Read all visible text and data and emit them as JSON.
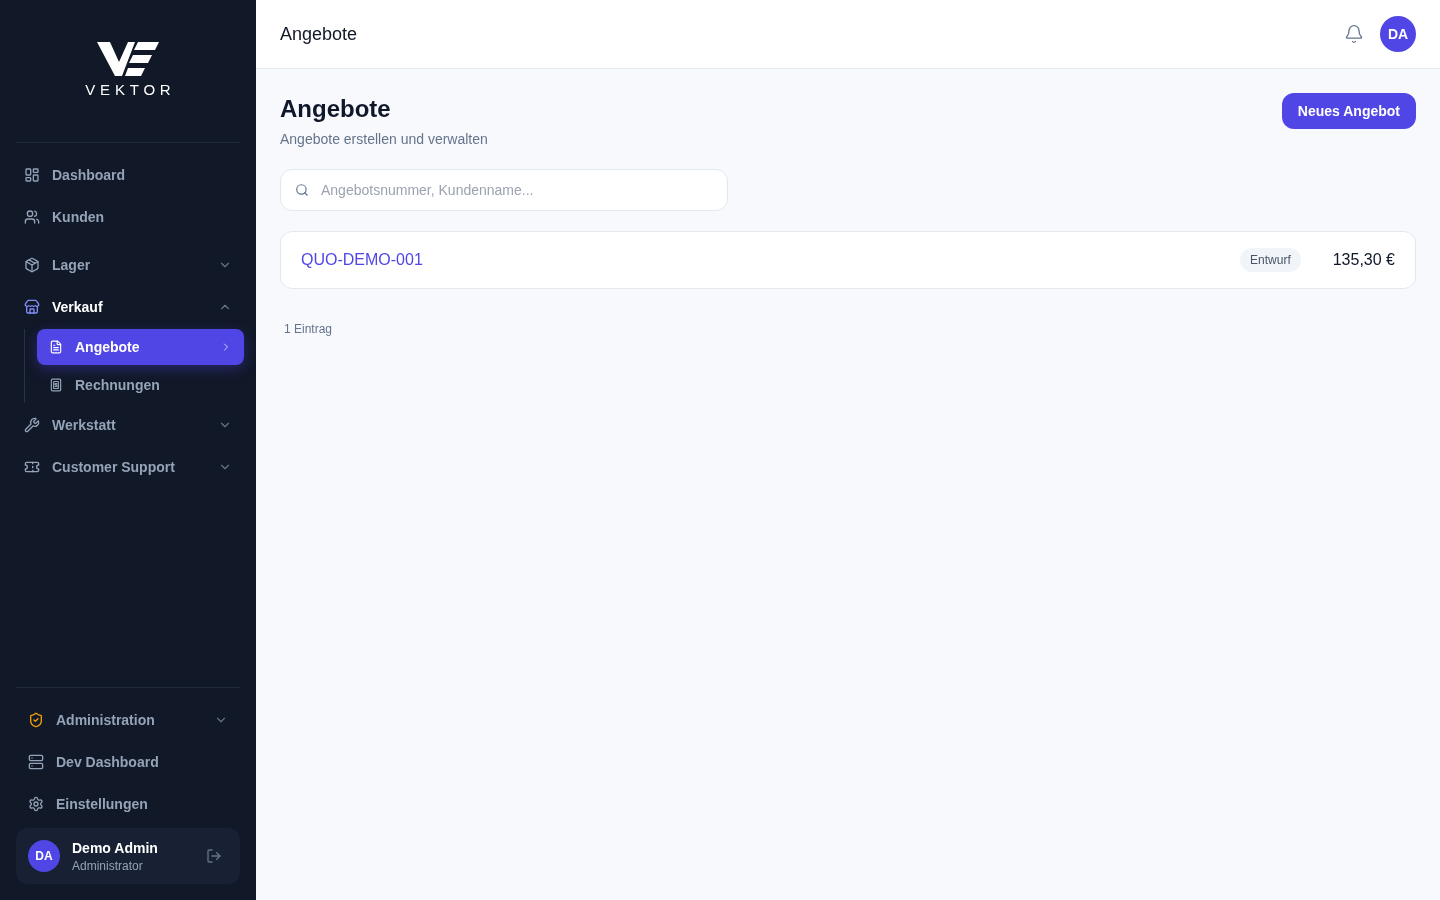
{
  "sidebar": {
    "logo": {
      "wordmark": "VEKTOR"
    },
    "nav": [
      {
        "label": "Dashboard",
        "kind": "link",
        "selected": false
      },
      {
        "label": "Kunden",
        "kind": "link",
        "selected": false
      },
      {
        "label": "Lager",
        "kind": "group",
        "selected": false,
        "expanded": false
      },
      {
        "label": "Verkauf",
        "kind": "group",
        "selected": true,
        "expanded": true,
        "children": [
          {
            "label": "Angebote",
            "selected": true
          },
          {
            "label": "Rechnungen",
            "selected": false
          }
        ]
      },
      {
        "label": "Werkstatt",
        "kind": "group",
        "selected": false,
        "expanded": false
      },
      {
        "label": "Customer Support",
        "kind": "group",
        "selected": false,
        "expanded": false
      }
    ],
    "bottom_nav": [
      {
        "label": "Administration",
        "kind": "group",
        "selected": false,
        "expanded": false
      },
      {
        "label": "Dev Dashboard",
        "kind": "link",
        "selected": false
      },
      {
        "label": "Einstellungen",
        "kind": "link",
        "selected": false
      }
    ],
    "user": {
      "initials": "DA",
      "name": "Demo Admin",
      "role": "Administrator"
    }
  },
  "header": {
    "title": "Angebote",
    "avatar_initials": "DA"
  },
  "page": {
    "title": "Angebote",
    "subtitle": "Angebote erstellen und verwalten",
    "new_button": "Neues Angebot",
    "search": {
      "placeholder": "Angebotsnummer, Kundenname..."
    },
    "quotes": [
      {
        "number": "QUO-DEMO-001",
        "status": "Entwurf",
        "amount": "135,30 €"
      }
    ],
    "count": "1 Eintrag"
  }
}
